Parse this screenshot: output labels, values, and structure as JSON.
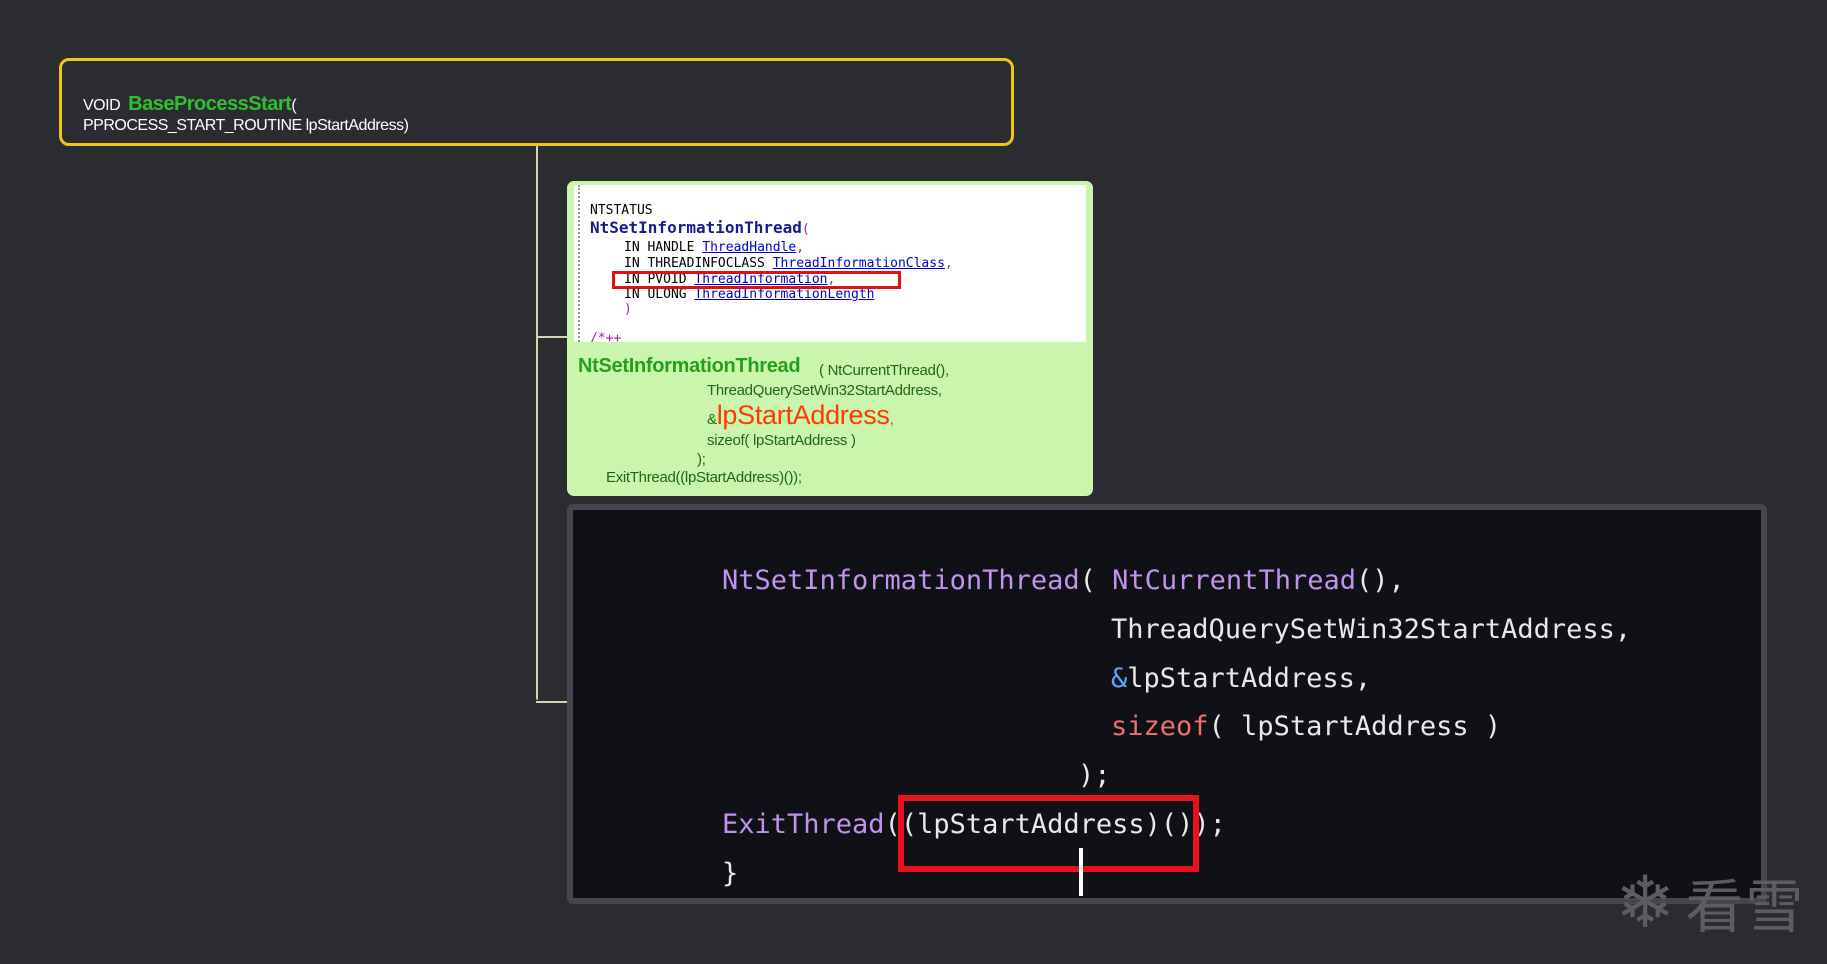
{
  "root_node": {
    "return_type": "VOID",
    "function_name": "BaseProcessStart",
    "open_paren": "(",
    "param_line": "PPROCESS_START_ROUTINE lpStartAddress)"
  },
  "doc_snippet": {
    "top_char": "'",
    "type_line": "NTSTATUS",
    "function_name": "NtSetInformationThread",
    "open_paren": "(",
    "params": [
      {
        "prefix": "IN HANDLE ",
        "name": "ThreadHandle",
        "suffix": ","
      },
      {
        "prefix": "IN THREADINFOCLASS ",
        "name": "ThreadInformationClass",
        "suffix": ","
      },
      {
        "prefix": "IN PVOID ",
        "name": "ThreadInformation",
        "suffix": ","
      },
      {
        "prefix": "IN ULONG ",
        "name": "ThreadInformationLength",
        "suffix": ""
      }
    ],
    "close_paren": ")",
    "comment_start": "/*++"
  },
  "green_node": {
    "function_name": "NtSetInformationThread",
    "arg1": "( NtCurrentThread(),",
    "arg2": "ThreadQuerySetWin32StartAddress,",
    "amp": "&",
    "arg3_name": "lpStartAddress",
    "arg3_suffix": ",",
    "arg4": "sizeof( lpStartAddress )",
    "close": ");",
    "exit_line": "ExitThread((lpStartAddress)());"
  },
  "code_panel": {
    "line1_fn": "NtSetInformationThread",
    "line1_open": "( ",
    "line1_arg_fn": "NtCurrentThread",
    "line1_arg_rest": "(),",
    "line2": "ThreadQuerySetWin32StartAddress,",
    "line3_amp": "&",
    "line3_rest": "lpStartAddress,",
    "line4_kw": "sizeof",
    "line4_rest": "( lpStartAddress )",
    "line5": ");",
    "line6_fn": "ExitThread",
    "line6_rest": "((lpStartAddress)());",
    "line7": "}"
  },
  "watermark": {
    "icon": "snowflake-icon",
    "text": "看雪"
  },
  "colors": {
    "root_border": "#f0c21a",
    "green_node_bg": "#c9f5ad",
    "highlight_red": "#e8121e",
    "code_bg": "#0f1117"
  }
}
